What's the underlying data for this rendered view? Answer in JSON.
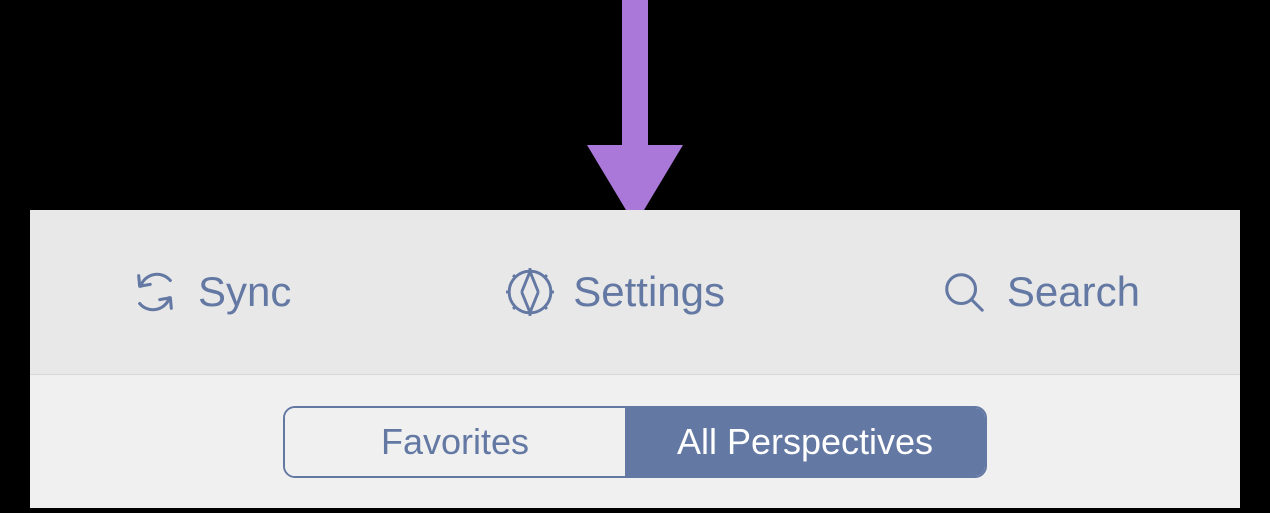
{
  "annotation": {
    "arrow_color": "#a978d9"
  },
  "toolbar": {
    "sync_label": "Sync",
    "settings_label": "Settings",
    "search_label": "Search",
    "icon_color": "#6378a3"
  },
  "segments": {
    "favorites_label": "Favorites",
    "all_perspectives_label": "All Perspectives",
    "active": "all_perspectives"
  }
}
